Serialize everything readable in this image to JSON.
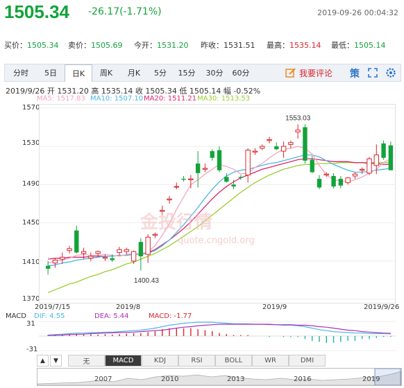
{
  "header": {
    "price": "1505.34",
    "change": "-26.17(-1.71%)",
    "timestamp": "2019-09-26 00:04:32"
  },
  "quotes": [
    {
      "label": "买价：",
      "value": "1505.34",
      "color": "green"
    },
    {
      "label": "卖价：",
      "value": "1505.69",
      "color": "green"
    },
    {
      "label": "今开：",
      "value": "1531.20",
      "color": "green"
    },
    {
      "label": "昨收：",
      "value": "1531.51",
      "color": "black"
    },
    {
      "label": "最高：",
      "value": "1535.14",
      "color": "red"
    },
    {
      "label": "最低：",
      "value": "1505.14",
      "color": "green"
    }
  ],
  "tabs": [
    "分时",
    "5日",
    "日K",
    "周K",
    "月K",
    "5分",
    "15分",
    "30分",
    "60分"
  ],
  "active_tab": "日K",
  "comment_label": "我要评论",
  "strategy_icon_label": "策",
  "ohlc_line": "2019/9/26  开 1531.20  高 1535.14  收 1505.34  低 1505.14  幅 -0.52%",
  "ma": [
    {
      "label": "MA5: 1517.83",
      "color": "#f4a7c0"
    },
    {
      "label": "MA10: 1507.10",
      "color": "#4bb8e6"
    },
    {
      "label": "MA20: 1511.21",
      "color": "#e0246f"
    },
    {
      "label": "MA30: 1513.53",
      "color": "#9acd32"
    }
  ],
  "y_ticks": [
    "1570",
    "1530",
    "1490",
    "1450",
    "1410",
    "1370"
  ],
  "x_ticks": [
    "2019/7/15",
    "2019/8",
    "2019/9",
    "2019/9/26"
  ],
  "annotations": {
    "high": "1553.03",
    "low": "1400.43"
  },
  "macd": {
    "dif": "DIF: 4.55",
    "dea": "DEA: 5.44",
    "macd": "MACD: -1.77",
    "top": "31",
    "bottom": "-31"
  },
  "bottom_tabs": [
    "无",
    "MACD",
    "KDJ",
    "RSI",
    "BOLL",
    "WR",
    "DMI"
  ],
  "active_bottom": "MACD",
  "timeline_years": [
    "2007",
    "2010",
    "2013",
    "2016",
    "2019"
  ],
  "colors": {
    "up": "#d8262c",
    "down": "#12a33a",
    "accent": "#2e74c9"
  },
  "chart_data": {
    "type": "candlestick",
    "ylim": [
      1370,
      1570
    ],
    "candles": [
      {
        "o": 1405,
        "h": 1410,
        "l": 1396,
        "c": 1402
      },
      {
        "o": 1408,
        "h": 1413,
        "l": 1403,
        "c": 1411
      },
      {
        "o": 1412,
        "h": 1419,
        "l": 1407,
        "c": 1414
      },
      {
        "o": 1421,
        "h": 1426,
        "l": 1418,
        "c": 1423
      },
      {
        "o": 1442,
        "h": 1447,
        "l": 1418,
        "c": 1419
      },
      {
        "o": 1418,
        "h": 1424,
        "l": 1412,
        "c": 1420
      },
      {
        "o": 1413,
        "h": 1419,
        "l": 1410,
        "c": 1415
      },
      {
        "o": 1418,
        "h": 1421,
        "l": 1414,
        "c": 1420
      },
      {
        "o": 1413,
        "h": 1417,
        "l": 1410,
        "c": 1414
      },
      {
        "o": 1413,
        "h": 1417,
        "l": 1409,
        "c": 1411
      },
      {
        "o": 1419,
        "h": 1425,
        "l": 1416,
        "c": 1422
      },
      {
        "o": 1420,
        "h": 1424,
        "l": 1417,
        "c": 1422
      },
      {
        "o": 1410,
        "h": 1421,
        "l": 1407,
        "c": 1420
      },
      {
        "o": 1430,
        "h": 1434,
        "l": 1400,
        "c": 1415
      },
      {
        "o": 1417,
        "h": 1438,
        "l": 1408,
        "c": 1435
      },
      {
        "o": 1437,
        "h": 1440,
        "l": 1434,
        "c": 1438
      },
      {
        "o": 1462,
        "h": 1468,
        "l": 1458,
        "c": 1463
      },
      {
        "o": 1474,
        "h": 1478,
        "l": 1470,
        "c": 1475
      },
      {
        "o": 1488,
        "h": 1492,
        "l": 1485,
        "c": 1488
      },
      {
        "o": 1496,
        "h": 1499,
        "l": 1493,
        "c": 1495
      },
      {
        "o": 1495,
        "h": 1500,
        "l": 1486,
        "c": 1496
      },
      {
        "o": 1512,
        "h": 1525,
        "l": 1487,
        "c": 1502
      },
      {
        "o": 1506,
        "h": 1512,
        "l": 1503,
        "c": 1507
      },
      {
        "o": 1525,
        "h": 1527,
        "l": 1515,
        "c": 1518
      },
      {
        "o": 1526,
        "h": 1530,
        "l": 1503,
        "c": 1505
      },
      {
        "o": 1498,
        "h": 1502,
        "l": 1492,
        "c": 1493
      },
      {
        "o": 1490,
        "h": 1495,
        "l": 1485,
        "c": 1488
      },
      {
        "o": 1498,
        "h": 1500,
        "l": 1495,
        "c": 1497
      },
      {
        "o": 1500,
        "h": 1528,
        "l": 1492,
        "c": 1526
      },
      {
        "o": 1524,
        "h": 1528,
        "l": 1521,
        "c": 1525
      },
      {
        "o": 1528,
        "h": 1532,
        "l": 1526,
        "c": 1530
      },
      {
        "o": 1536,
        "h": 1540,
        "l": 1533,
        "c": 1537
      },
      {
        "o": 1530,
        "h": 1534,
        "l": 1526,
        "c": 1527
      },
      {
        "o": 1525,
        "h": 1535,
        "l": 1518,
        "c": 1530
      },
      {
        "o": 1532,
        "h": 1536,
        "l": 1528,
        "c": 1534
      },
      {
        "o": 1545,
        "h": 1553,
        "l": 1538,
        "c": 1547
      },
      {
        "o": 1550,
        "h": 1553,
        "l": 1512,
        "c": 1515
      },
      {
        "o": 1516,
        "h": 1520,
        "l": 1502,
        "c": 1503
      },
      {
        "o": 1496,
        "h": 1500,
        "l": 1485,
        "c": 1487
      },
      {
        "o": 1500,
        "h": 1503,
        "l": 1498,
        "c": 1501
      },
      {
        "o": 1499,
        "h": 1502,
        "l": 1486,
        "c": 1488
      },
      {
        "o": 1496,
        "h": 1499,
        "l": 1486,
        "c": 1489
      },
      {
        "o": 1492,
        "h": 1498,
        "l": 1490,
        "c": 1497
      },
      {
        "o": 1499,
        "h": 1503,
        "l": 1496,
        "c": 1501
      },
      {
        "o": 1505,
        "h": 1508,
        "l": 1501,
        "c": 1506
      },
      {
        "o": 1502,
        "h": 1519,
        "l": 1500,
        "c": 1517
      },
      {
        "o": 1510,
        "h": 1532,
        "l": 1501,
        "c": 1521
      },
      {
        "o": 1533,
        "h": 1536,
        "l": 1516,
        "c": 1518
      },
      {
        "o": 1531,
        "h": 1535,
        "l": 1505,
        "c": 1505
      }
    ],
    "ma5": [
      1408,
      1410,
      1411,
      1413,
      1416,
      1417,
      1416,
      1416,
      1417,
      1416,
      1415,
      1417,
      1418,
      1417,
      1420,
      1426,
      1437,
      1449,
      1464,
      1477,
      1490,
      1495,
      1501,
      1506,
      1511,
      1509,
      1506,
      1501,
      1502,
      1508,
      1512,
      1518,
      1523,
      1527,
      1528,
      1530,
      1528,
      1522,
      1510,
      1500,
      1495,
      1494,
      1493,
      1495,
      1498,
      1502,
      1506,
      1513,
      1517
    ],
    "ma10": [
      1405,
      1406,
      1408,
      1409,
      1411,
      1412,
      1413,
      1414,
      1415,
      1415,
      1416,
      1416,
      1417,
      1417,
      1418,
      1421,
      1426,
      1432,
      1440,
      1448,
      1457,
      1466,
      1476,
      1485,
      1493,
      1499,
      1503,
      1505,
      1506,
      1508,
      1510,
      1512,
      1513,
      1515,
      1517,
      1519,
      1521,
      1521,
      1519,
      1515,
      1511,
      1508,
      1505,
      1503,
      1503,
      1504,
      1505,
      1506,
      1507
    ],
    "ma20": [
      1412,
      1413,
      1413,
      1414,
      1414,
      1414,
      1415,
      1415,
      1415,
      1415,
      1416,
      1416,
      1417,
      1418,
      1419,
      1422,
      1427,
      1432,
      1438,
      1444,
      1451,
      1459,
      1467,
      1475,
      1482,
      1488,
      1493,
      1497,
      1500,
      1503,
      1506,
      1508,
      1510,
      1512,
      1514,
      1516,
      1517,
      1517,
      1516,
      1515,
      1514,
      1514,
      1514,
      1513,
      1513,
      1512,
      1512,
      1511,
      1511
    ],
    "ma30": [
      1377,
      1380,
      1383,
      1386,
      1388,
      1391,
      1394,
      1396,
      1399,
      1401,
      1404,
      1407,
      1409,
      1412,
      1415,
      1418,
      1422,
      1426,
      1431,
      1436,
      1441,
      1446,
      1452,
      1458,
      1464,
      1470,
      1476,
      1482,
      1487,
      1492,
      1496,
      1500,
      1503,
      1506,
      1508,
      1510,
      1511,
      1511,
      1512,
      1512,
      1512,
      1513,
      1513,
      1513,
      1513,
      1513,
      1513,
      1513,
      1513
    ],
    "macd_dif": [
      2,
      3,
      4,
      5,
      6,
      6,
      7,
      7,
      8,
      8,
      9,
      10,
      11,
      12,
      14,
      16,
      19,
      22,
      24,
      26,
      27,
      28,
      28,
      28,
      27,
      26,
      25,
      25,
      25,
      24,
      24,
      23,
      23,
      22,
      22,
      21,
      19,
      16,
      13,
      11,
      9,
      8,
      7,
      6,
      6,
      5,
      5,
      5,
      4.55
    ],
    "macd_dea": [
      1,
      1.5,
      2,
      3,
      3.5,
      4,
      5,
      5.5,
      6,
      6.5,
      7,
      7.5,
      8,
      9,
      10,
      11,
      12,
      14,
      16,
      18,
      19,
      21,
      22,
      23,
      24,
      24,
      24,
      24,
      24,
      24,
      24,
      24,
      23,
      23,
      23,
      22,
      22,
      21,
      19,
      18,
      16,
      14,
      12,
      11,
      9,
      8,
      7,
      6,
      5.44
    ]
  }
}
